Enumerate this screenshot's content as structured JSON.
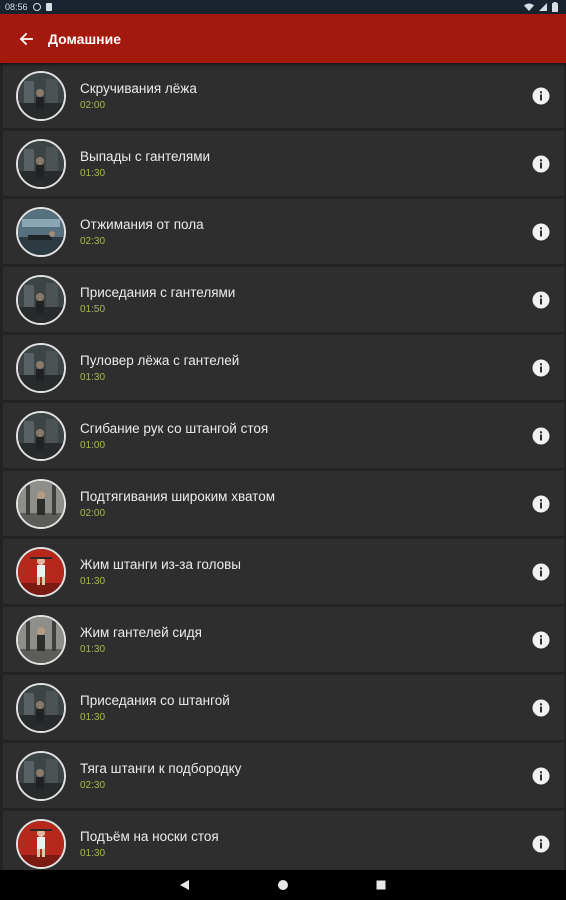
{
  "status_bar": {
    "time": "08:56",
    "icons": [
      "sync-icon",
      "document-icon",
      "wifi-icon",
      "signal-icon",
      "battery-icon"
    ]
  },
  "app_bar": {
    "title": "Домашние",
    "background_color": "#a3190d",
    "back_icon": "arrow-left-icon"
  },
  "exercises": [
    {
      "title": "Скручивания лёжа",
      "time": "02:00",
      "thumb": "gym-dark"
    },
    {
      "title": "Выпады с гантелями",
      "time": "01:30",
      "thumb": "gym-dark"
    },
    {
      "title": "Отжимания от пола",
      "time": "02:30",
      "thumb": "gym-blue"
    },
    {
      "title": "Приседания с гантелями",
      "time": "01:50",
      "thumb": "gym-dark"
    },
    {
      "title": "Пуловер лёжа с гантелей",
      "time": "01:30",
      "thumb": "gym-dark"
    },
    {
      "title": "Сгибание рук со штангой стоя",
      "time": "01:00",
      "thumb": "gym-dark"
    },
    {
      "title": "Подтягивания широким хватом",
      "time": "02:00",
      "thumb": "gym-light"
    },
    {
      "title": "Жим штанги из-за головы",
      "time": "01:30",
      "thumb": "studio-red"
    },
    {
      "title": "Жим гантелей сидя",
      "time": "01:30",
      "thumb": "gym-light"
    },
    {
      "title": "Приседания со штангой",
      "time": "01:30",
      "thumb": "gym-dark"
    },
    {
      "title": "Тяга штанги к подбородку",
      "time": "02:30",
      "thumb": "gym-dark"
    },
    {
      "title": "Подъём на носки стоя",
      "time": "01:30",
      "thumb": "studio-red"
    }
  ],
  "info_icon": "info-icon",
  "nav_bar": {
    "icons": [
      "back-triangle-icon",
      "home-circle-icon",
      "recents-square-icon"
    ]
  },
  "colors": {
    "time_text": "#a9b74c",
    "item_background": "#2e2e2e",
    "screen_background": "#232323"
  }
}
